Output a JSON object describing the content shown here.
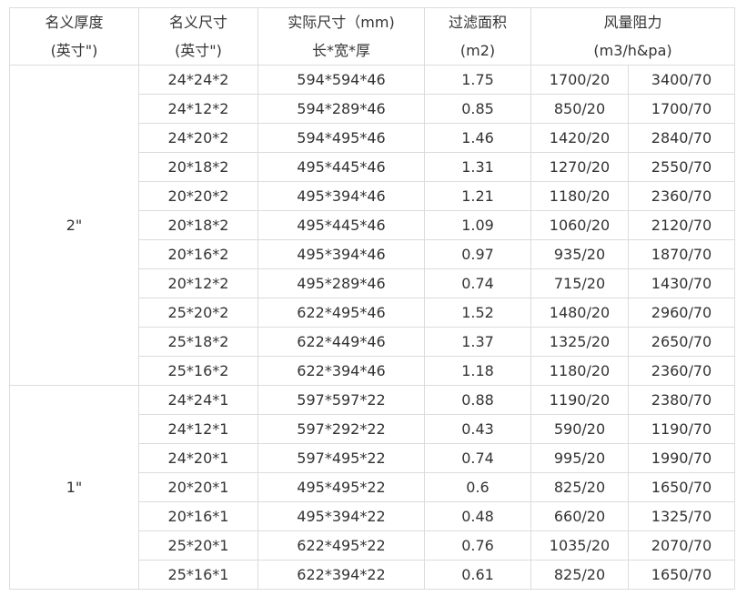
{
  "header": {
    "thickness": [
      "名义厚度",
      "(英寸\")"
    ],
    "size": [
      "名义尺寸",
      "(英寸\")"
    ],
    "actual": [
      "实际尺寸（mm)",
      "长*宽*厚"
    ],
    "area": [
      "过滤面积",
      "(m2)"
    ],
    "airflow": [
      "风量阻力",
      "(m3/h&pa)"
    ]
  },
  "groups": [
    {
      "thickness": "2\"",
      "rows": [
        [
          "24*24*2",
          "594*594*46",
          "1.75",
          "1700/20",
          "3400/70"
        ],
        [
          "24*12*2",
          "594*289*46",
          "0.85",
          "850/20",
          "1700/70"
        ],
        [
          "24*20*2",
          "594*495*46",
          "1.46",
          "1420/20",
          "2840/70"
        ],
        [
          "20*18*2",
          "495*445*46",
          "1.31",
          "1270/20",
          "2550/70"
        ],
        [
          "20*20*2",
          "495*394*46",
          "1.21",
          "1180/20",
          "2360/70"
        ],
        [
          "20*18*2",
          "495*445*46",
          "1.09",
          "1060/20",
          "2120/70"
        ],
        [
          "20*16*2",
          "495*394*46",
          "0.97",
          "935/20",
          "1870/70"
        ],
        [
          "20*12*2",
          "495*289*46",
          "0.74",
          "715/20",
          "1430/70"
        ],
        [
          "25*20*2",
          "622*495*46",
          "1.52",
          "1480/20",
          "2960/70"
        ],
        [
          "25*18*2",
          "622*449*46",
          "1.37",
          "1325/20",
          "2650/70"
        ],
        [
          "25*16*2",
          "622*394*46",
          "1.18",
          "1180/20",
          "2360/70"
        ]
      ]
    },
    {
      "thickness": "1\"",
      "rows": [
        [
          "24*24*1",
          "597*597*22",
          "0.88",
          "1190/20",
          "2380/70"
        ],
        [
          "24*12*1",
          "597*292*22",
          "0.43",
          "590/20",
          "1190/70"
        ],
        [
          "24*20*1",
          "597*495*22",
          "0.74",
          "995/20",
          "1990/70"
        ],
        [
          "20*20*1",
          "495*495*22",
          "0.6",
          "825/20",
          "1650/70"
        ],
        [
          "20*16*1",
          "495*394*22",
          "0.48",
          "660/20",
          "1325/70"
        ],
        [
          "25*20*1",
          "622*495*22",
          "0.76",
          "1035/20",
          "2070/70"
        ],
        [
          "25*16*1",
          "622*394*22",
          "0.61",
          "825/20",
          "1650/70"
        ]
      ]
    }
  ]
}
